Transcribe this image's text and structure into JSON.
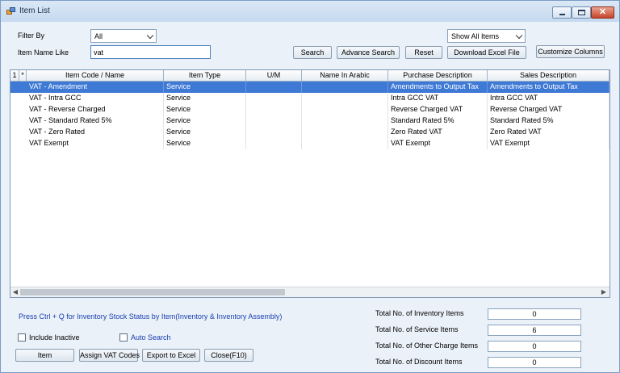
{
  "window": {
    "title": "Item List"
  },
  "filters": {
    "filter_by_label": "Filter By",
    "filter_by_value": "All",
    "item_name_label": "Item Name Like",
    "item_name_value": "vat",
    "show_items_value": "Show All Items"
  },
  "toolbar": {
    "search": "Search",
    "advance_search": "Advance Search",
    "reset": "Reset",
    "download_excel": "Download Excel File",
    "customize_columns": "Customize Columns"
  },
  "table": {
    "row_num_header": "1",
    "star_header": "*",
    "columns": [
      "Item Code / Name",
      "Item Type",
      "U/M",
      "Name In Arabic",
      "Purchase Description",
      "Sales Description"
    ],
    "rows": [
      [
        "VAT - Amendment",
        "Service",
        "",
        "",
        "Amendments to Output Tax",
        "Amendments to Output Tax"
      ],
      [
        "VAT - Intra GCC",
        "Service",
        "",
        "",
        "Intra GCC VAT",
        "Intra GCC VAT"
      ],
      [
        "VAT - Reverse Charged",
        "Service",
        "",
        "",
        "Reverse Charged VAT",
        "Reverse Charged VAT"
      ],
      [
        "VAT - Standard Rated 5%",
        "Service",
        "",
        "",
        "Standard Rated 5%",
        "Standard Rated 5%"
      ],
      [
        "VAT - Zero Rated",
        "Service",
        "",
        "",
        "Zero Rated VAT",
        "Zero Rated VAT"
      ],
      [
        "VAT Exempt",
        "Service",
        "",
        "",
        "VAT Exempt",
        "VAT Exempt"
      ]
    ],
    "selected_row": 0
  },
  "footer": {
    "hint": "Press Ctrl + Q for Inventory Stock Status by Item(Inventory & Inventory Assembly)",
    "include_inactive": "Include Inactive",
    "auto_search": "Auto Search",
    "buttons": {
      "item": "Item",
      "assign_vat": "Assign VAT Codes",
      "export_excel": "Export to Excel",
      "close": "Close(F10)"
    },
    "totals": [
      {
        "label": "Total No. of Inventory Items",
        "value": "0"
      },
      {
        "label": "Total No. of Service Items",
        "value": "6"
      },
      {
        "label": "Total No. of Other Charge Items",
        "value": "0"
      },
      {
        "label": "Total No. of Discount Items",
        "value": "0"
      }
    ]
  },
  "colors": {
    "selection": "#3e79d6",
    "hint_text": "#1a3fb3",
    "window_bg": "#eaf1f8"
  }
}
